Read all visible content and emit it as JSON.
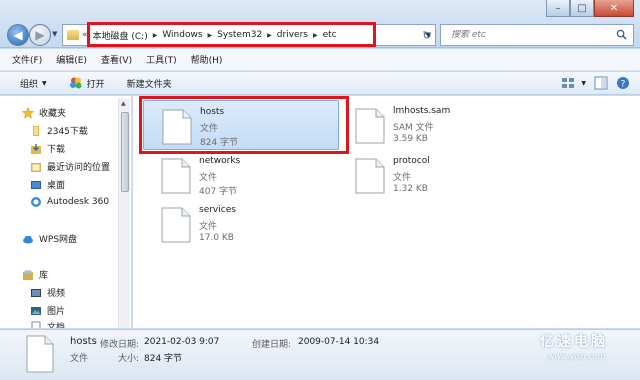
{
  "window": {
    "minimize_label": "–",
    "maximize_label": "□",
    "close_label": "✕"
  },
  "address": {
    "overflow": "«",
    "crumbs": [
      "本地磁盘 (C:)",
      "Windows",
      "System32",
      "drivers",
      "etc"
    ]
  },
  "search": {
    "placeholder": "搜索 etc"
  },
  "menu": [
    "文件(F)",
    "编辑(E)",
    "查看(V)",
    "工具(T)",
    "帮助(H)"
  ],
  "toolbar": {
    "organize": "组织",
    "open": "打开",
    "new_folder": "新建文件夹"
  },
  "nav": {
    "favorites": "收藏夹",
    "downloads_2345": "2345下载",
    "downloads": "下载",
    "recent": "最近访问的位置",
    "desktop": "桌面",
    "autodesk": "Autodesk 360",
    "wps": "WPS网盘",
    "libraries": "库",
    "videos": "视频",
    "pictures": "图片",
    "documents": "文档"
  },
  "files": [
    {
      "name": "hosts",
      "type": "文件",
      "size": "824 字节"
    },
    {
      "name": "lmhosts.sam",
      "type": "SAM 文件",
      "size": "3.59 KB"
    },
    {
      "name": "networks",
      "type": "文件",
      "size": "407 字节"
    },
    {
      "name": "protocol",
      "type": "文件",
      "size": "1.32 KB"
    },
    {
      "name": "services",
      "type": "文件",
      "size": "17.0 KB"
    }
  ],
  "details": {
    "name": "hosts",
    "modified_label": "修改日期:",
    "modified": "2021-02-03 9:07",
    "created_label": "创建日期:",
    "created": "2009-07-14 10:34",
    "type": "文件",
    "size_label": "大小:",
    "size": "824 字节"
  },
  "watermark": {
    "main": "亿速电脑",
    "sub": "www.yisu.com"
  },
  "colors": {
    "highlight": "#e0141c",
    "selection": "#c3dcf6",
    "chrome": "#c9daf0"
  }
}
